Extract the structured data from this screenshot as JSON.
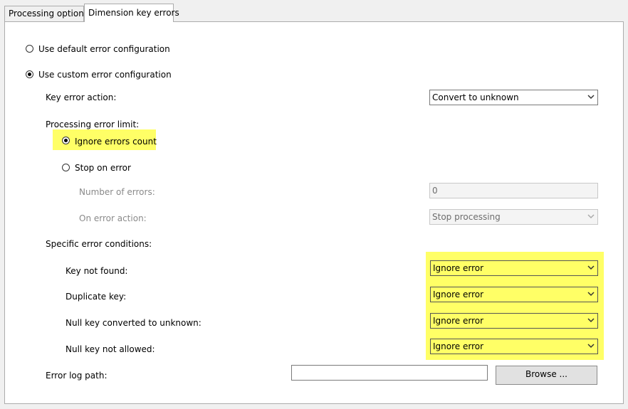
{
  "tabs": [
    {
      "label": "Processing options",
      "active": false
    },
    {
      "label": "Dimension key errors",
      "active": true
    }
  ],
  "config": {
    "default_label": "Use default error configuration",
    "custom_label": "Use custom error configuration",
    "selected": "custom"
  },
  "key_error_action": {
    "label": "Key error action:",
    "value": "Convert to unknown"
  },
  "processing_error_limit": {
    "label": "Processing error limit:",
    "ignore_label": "Ignore errors count",
    "stop_label": "Stop on error",
    "selected": "ignore",
    "number_of_errors_label": "Number of errors:",
    "number_of_errors_value": "0",
    "on_error_action_label": "On error action:",
    "on_error_action_value": "Stop processing"
  },
  "specific_conditions": {
    "label": "Specific error conditions:",
    "items": [
      {
        "label": "Key not found:",
        "value": "Ignore error"
      },
      {
        "label": "Duplicate key:",
        "value": "Ignore error"
      },
      {
        "label": "Null key converted to unknown:",
        "value": "Ignore error"
      },
      {
        "label": "Null key not allowed:",
        "value": "Ignore error"
      }
    ]
  },
  "error_log": {
    "label": "Error log path:",
    "value": "",
    "browse_label": "Browse ..."
  },
  "colors": {
    "highlight": "#ffff66",
    "panel_bg": "#ffffff",
    "window_bg": "#f0f0f0"
  }
}
